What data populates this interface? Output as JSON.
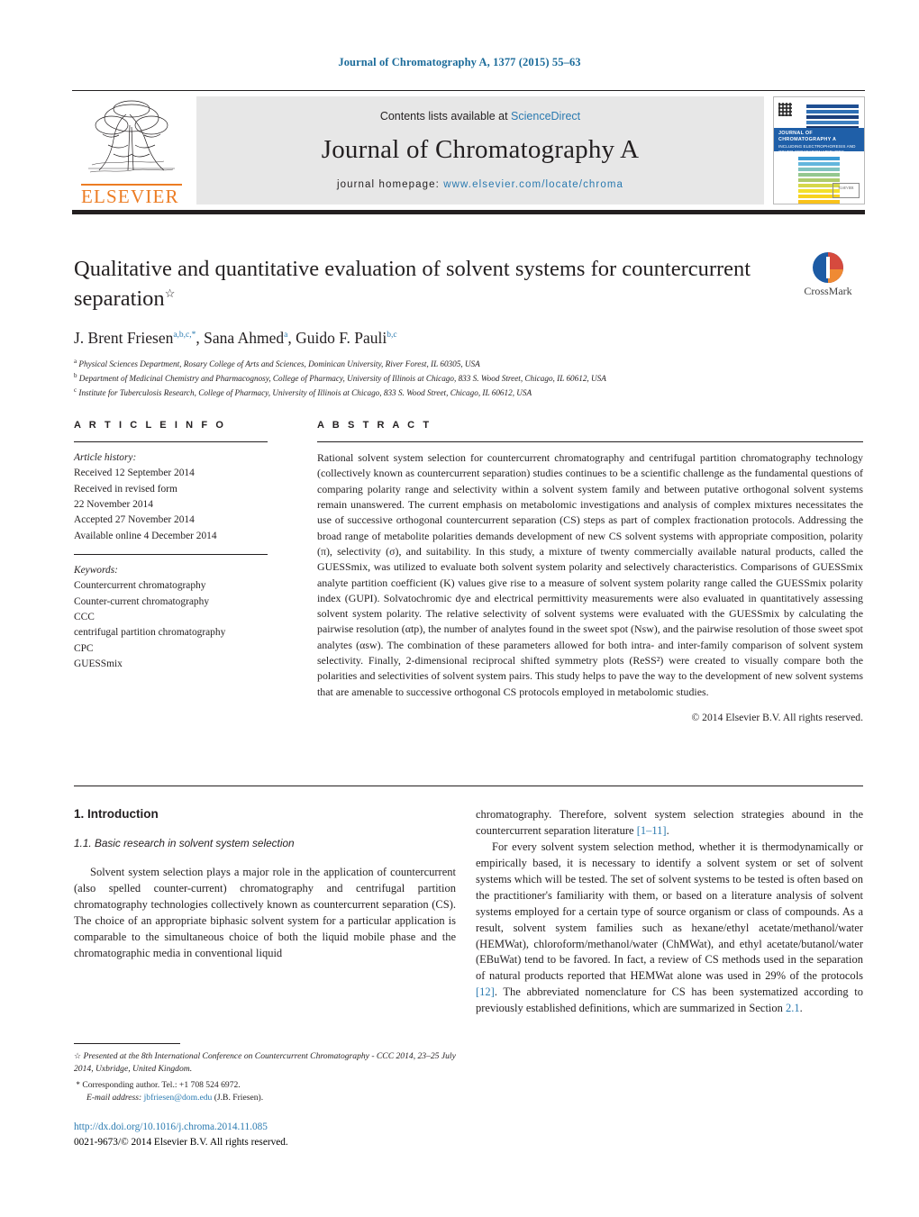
{
  "running_head": "Journal of Chromatography A, 1377 (2015) 55–63",
  "masthead": {
    "contents_prefix": "Contents lists available at ",
    "sciencedirect": "ScienceDirect",
    "journal_name": "Journal of Chromatography A",
    "homepage_prefix": "journal homepage: ",
    "homepage_url": "www.elsevier.com/locate/chroma",
    "publisher": "ELSEVIER",
    "cover": {
      "title": "JOURNAL OF CHROMATOGRAPHY A",
      "subtitle": "INCLUDING ELECTROPHORESIS AND OTHER SEPARATION METHODS INTERNATIONAL JOURNAL ON CHROMATOGRAPHY",
      "logo_text": "ELSEVIER"
    }
  },
  "article": {
    "title": "Qualitative and quantitative evaluation of solvent systems for countercurrent separation",
    "title_footnote_mark": "☆",
    "authors": [
      {
        "name": "J. Brent Friesen",
        "sup": "a,b,c,*"
      },
      {
        "name": "Sana Ahmed",
        "sup": "a"
      },
      {
        "name": "Guido F. Pauli",
        "sup": "b,c"
      }
    ],
    "affiliations": [
      {
        "mark": "a",
        "text": "Physical Sciences Department, Rosary College of Arts and Sciences, Dominican University, River Forest, IL 60305, USA"
      },
      {
        "mark": "b",
        "text": "Department of Medicinal Chemistry and Pharmacognosy, College of Pharmacy, University of Illinois at Chicago, 833 S. Wood Street, Chicago, IL 60612, USA"
      },
      {
        "mark": "c",
        "text": "Institute for Tuberculosis Research, College of Pharmacy, University of Illinois at Chicago, 833 S. Wood Street, Chicago, IL 60612, USA"
      }
    ]
  },
  "crossmark": {
    "label": "CrossMark"
  },
  "article_info": {
    "heading": "A R T I C L E    I N F O",
    "history_label": "Article history:",
    "history": [
      "Received 12 September 2014",
      "Received in revised form",
      "22 November 2014",
      "Accepted 27 November 2014",
      "Available online 4 December 2014"
    ],
    "keywords_label": "Keywords:",
    "keywords": [
      "Countercurrent chromatography",
      "Counter-current chromatography",
      "CCC",
      "centrifugal partition chromatography",
      "CPC",
      "GUESSmix"
    ]
  },
  "abstract": {
    "heading": "A B S T R A C T",
    "text": "Rational solvent system selection for countercurrent chromatography and centrifugal partition chromatography technology (collectively known as countercurrent separation) studies continues to be a scientific challenge as the fundamental questions of comparing polarity range and selectivity within a solvent system family and between putative orthogonal solvent systems remain unanswered. The current emphasis on metabolomic investigations and analysis of complex mixtures necessitates the use of successive orthogonal countercurrent separation (CS) steps as part of complex fractionation protocols. Addressing the broad range of metabolite polarities demands development of new CS solvent systems with appropriate composition, polarity (π), selectivity (σ), and suitability. In this study, a mixture of twenty commercially available natural products, called the GUESSmix, was utilized to evaluate both solvent system polarity and selectively characteristics. Comparisons of GUESSmix analyte partition coefficient (K) values give rise to a measure of solvent system polarity range called the GUESSmix polarity index (GUPI). Solvatochromic dye and electrical permittivity measurements were also evaluated in quantitatively assessing solvent system polarity. The relative selectivity of solvent systems were evaluated with the GUESSmix by calculating the pairwise resolution (αtp), the number of analytes found in the sweet spot (Nsw), and the pairwise resolution of those sweet spot analytes (αsw). The combination of these parameters allowed for both intra- and inter-family comparison of solvent system selectivity. Finally, 2-dimensional reciprocal shifted symmetry plots (ReSS²) were created to visually compare both the polarities and selectivities of solvent system pairs. This study helps to pave the way to the development of new solvent systems that are amenable to successive orthogonal CS protocols employed in metabolomic studies.",
    "copyright": "© 2014 Elsevier B.V. All rights reserved."
  },
  "body": {
    "section_heading": "1.  Introduction",
    "subsection_heading": "1.1.  Basic research in solvent system selection",
    "left_paragraph": "Solvent system selection plays a major role in the application of countercurrent (also spelled counter-current) chromatography and centrifugal partition chromatography technologies collectively known as countercurrent separation (CS). The choice of an appropriate biphasic solvent system for a particular application is comparable to the simultaneous choice of both the liquid mobile phase and the chromatographic media in conventional liquid",
    "right_paragraph_1": "chromatography. Therefore, solvent system selection strategies abound in the countercurrent separation literature",
    "right_ref_1": "[1–11]",
    "right_paragraph_2a": "For every solvent system selection method, whether it is thermodynamically or empirically based, it is necessary to identify a solvent system or set of solvent systems which will be tested. The set of solvent systems to be tested is often based on the practitioner's familiarity with them, or based on a literature analysis of solvent systems employed for a certain type of source organism or class of compounds. As a result, solvent system families such as hexane/ethyl acetate/methanol/water (HEMWat), chloroform/methanol/water (ChMWat), and ethyl acetate/butanol/water (EBuWat) tend to be favored. In fact, a review of CS methods used in the separation of natural products reported that HEMWat alone was used in 29% of the protocols",
    "right_ref_2": "[12]",
    "right_paragraph_2b": ". The abbreviated nomenclature for CS has been systematized according to previously established definitions, which are summarized in Section",
    "right_ref_3": "2.1",
    "right_paragraph_2c": "."
  },
  "footnotes": {
    "conference_mark": "☆",
    "conference": "Presented at the 8th International Conference on Countercurrent Chromatography - CCC 2014, 23–25 July 2014, Uxbridge, United Kingdom.",
    "corresponding_mark": "*",
    "corresponding": "Corresponding author. Tel.: +1 708 524 6972.",
    "email_label": "E-mail address:",
    "email": "jbfriesen@dom.edu",
    "email_owner": "(J.B. Friesen)."
  },
  "footer": {
    "doi": "http://dx.doi.org/10.1016/j.chroma.2014.11.085",
    "issn_line": "0021-9673/© 2014 Elsevier B.V. All rights reserved."
  },
  "colors": {
    "link_blue": "#2a7ab0",
    "elsevier_orange": "#ec7c23",
    "cover_blue": "#1f5fa8"
  }
}
